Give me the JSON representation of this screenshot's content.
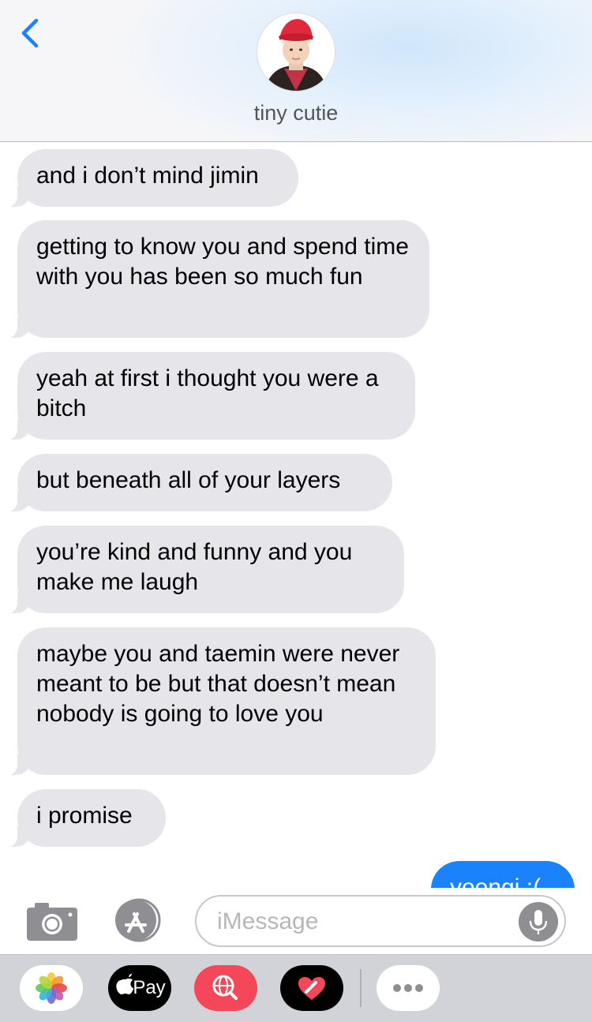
{
  "header": {
    "contact_name": "tiny cutie"
  },
  "messages": [
    {
      "from": "them",
      "text": "and i don’t mind jimin"
    },
    {
      "from": "them",
      "text": "getting to know you and spend time with you has been so much fun"
    },
    {
      "from": "them",
      "text": "yeah at first i thought you were a bitch"
    },
    {
      "from": "them",
      "text": "but beneath all of your layers"
    },
    {
      "from": "them",
      "text": "you’re kind and funny and you make me laugh"
    },
    {
      "from": "them",
      "text": "maybe you and taemin were never meant to be but that doesn’t mean nobody is going to love you"
    },
    {
      "from": "them",
      "text": "i promise"
    },
    {
      "from": "me",
      "text": "yoongi :("
    }
  ],
  "input": {
    "placeholder": "iMessage"
  },
  "dock": {
    "pay_label": "Pay"
  },
  "colors": {
    "incoming_bubble": "#e5e5ea",
    "outgoing_bubble": "#1a82fb",
    "accent": "#1a82fb",
    "search_app": "#f4475a"
  }
}
